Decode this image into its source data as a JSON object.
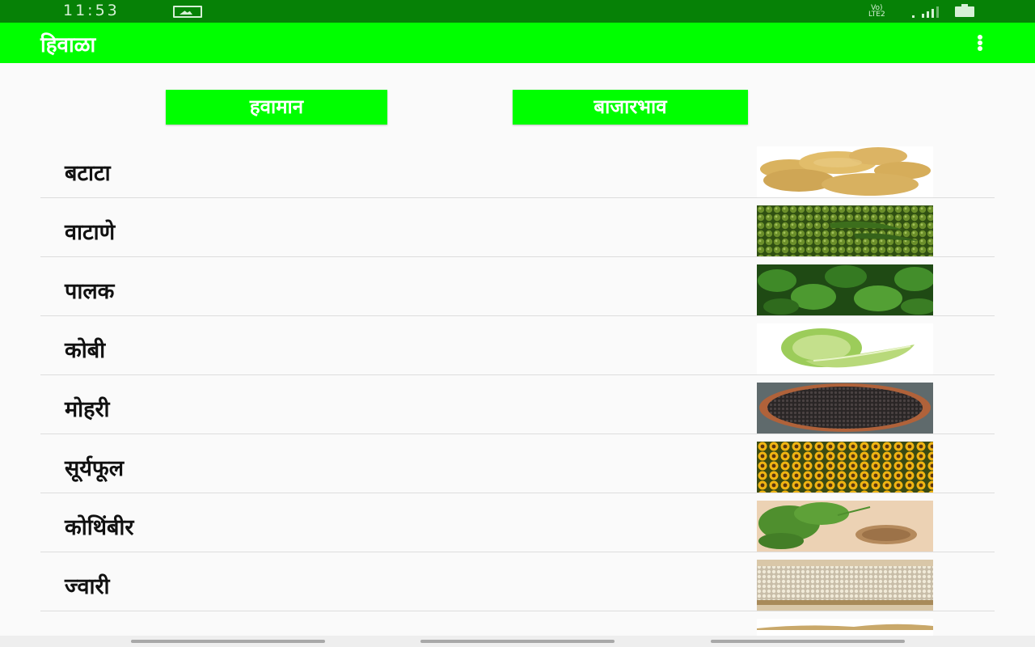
{
  "status_bar": {
    "time": "11:53",
    "network": "VoLTE2",
    "icons": [
      "image-icon",
      "signal-icon",
      "battery-icon"
    ]
  },
  "app_bar": {
    "title": "हिवाळा",
    "menu_icon": "overflow-menu-icon"
  },
  "tabs": {
    "weather": "हवामान",
    "market": "बाजारभाव"
  },
  "crops": [
    {
      "name": "बटाटा",
      "image": "potato"
    },
    {
      "name": "वाटाणे",
      "image": "peas"
    },
    {
      "name": "पालक",
      "image": "spinach"
    },
    {
      "name": "कोबी",
      "image": "cabbage"
    },
    {
      "name": "मोहरी",
      "image": "mustard-seeds"
    },
    {
      "name": "सूर्यफूल",
      "image": "sunflower-field"
    },
    {
      "name": "कोथिंबीर",
      "image": "coriander"
    },
    {
      "name": "ज्वारी",
      "image": "sorghum"
    }
  ],
  "colors": {
    "status_bar": "#068106",
    "accent": "#00ff00",
    "background": "#fafafa"
  }
}
